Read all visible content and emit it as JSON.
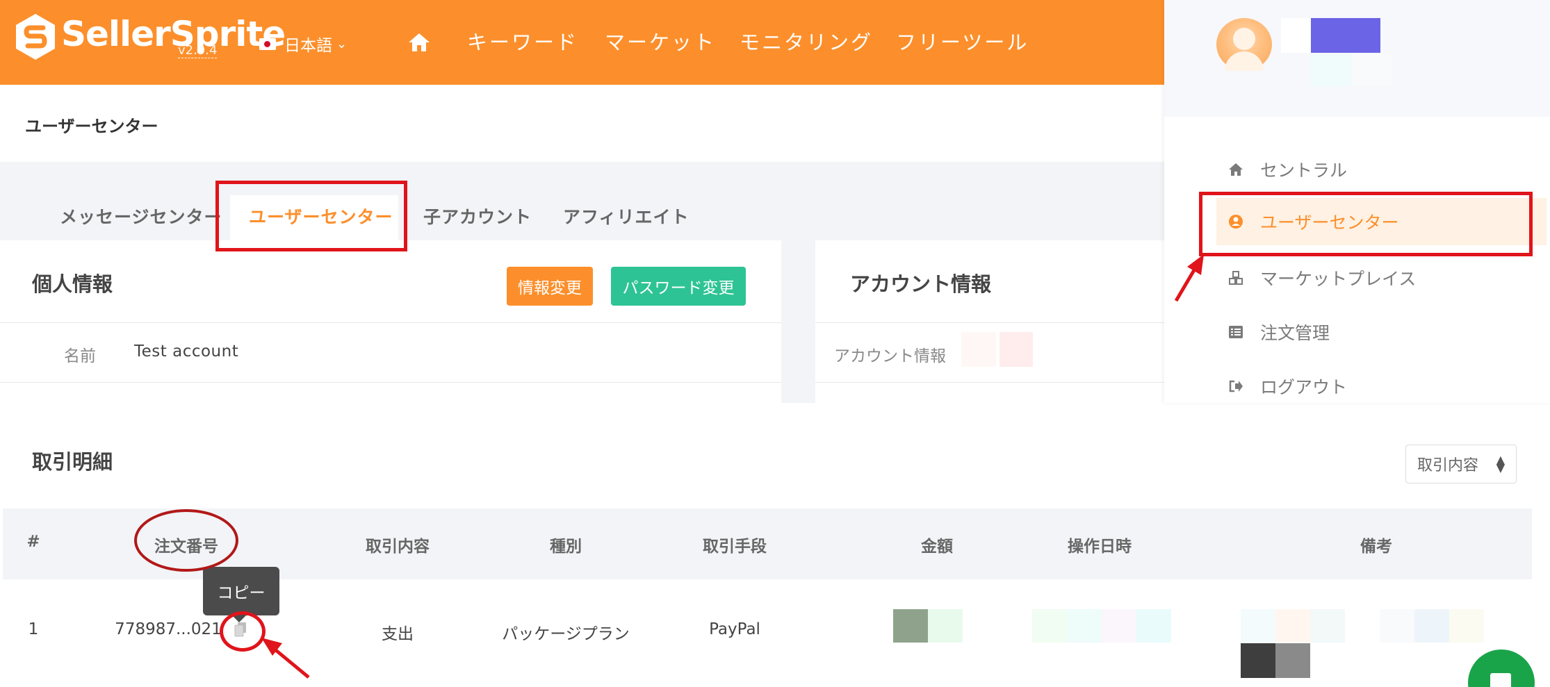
{
  "header": {
    "brand": "SellerSprite",
    "version": "v2.9.4",
    "language": "日本語",
    "nav": [
      "キーワード",
      "マーケット",
      "モニタリング",
      "フリーツール"
    ]
  },
  "breadcrumb": "ユーザーセンター",
  "tabs": [
    "メッセージセンター",
    "ユーザーセンター",
    "子アカウント",
    "アフィリエイト"
  ],
  "personal_info": {
    "title": "個人情報",
    "edit_button": "情報変更",
    "password_button": "パスワード変更",
    "name_label": "名前",
    "name_value": "Test account"
  },
  "account_info": {
    "title": "アカウント情報",
    "label": "アカウント情報"
  },
  "user_menu": {
    "items": [
      "セントラル",
      "ユーザーセンター",
      "マーケットプレイス",
      "注文管理",
      "ログアウト"
    ]
  },
  "transactions": {
    "title": "取引明細",
    "filter_label": "取引内容",
    "columns": [
      "#",
      "注文番号",
      "取引内容",
      "種別",
      "取引手段",
      "金額",
      "操作日時",
      "備考"
    ],
    "rows": [
      {
        "index": "1",
        "order_no": "778987...021",
        "type": "支出",
        "category": "パッケージプラン",
        "method": "PayPal"
      }
    ],
    "copy_tooltip": "コピー"
  },
  "colors": {
    "brand_orange": "#fc8f2b",
    "green": "#2ec394",
    "annotation_red": "#e0141b"
  }
}
